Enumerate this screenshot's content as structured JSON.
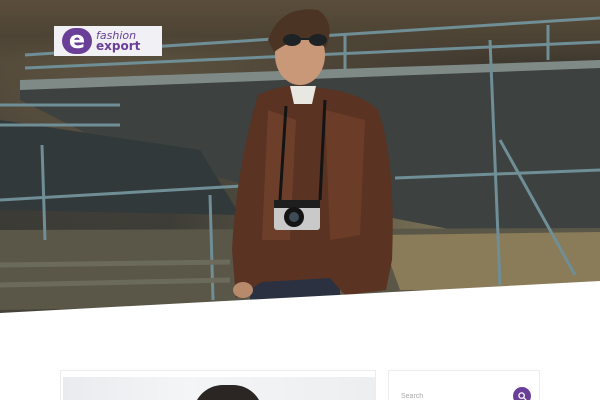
{
  "logo": {
    "mark": "e",
    "line1": "fashion",
    "line2": "export",
    "brand_color": "#6a3f97"
  },
  "hero": {
    "image_subject": "man in leather jacket with sunglasses and camera on rusty rooftop"
  },
  "sidebar": {
    "search": {
      "placeholder": "Search",
      "button_icon": "search-icon"
    }
  }
}
